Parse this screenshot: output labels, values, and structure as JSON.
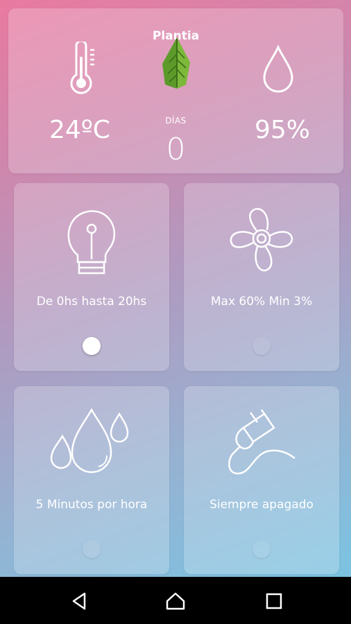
{
  "header": {
    "title": "Plantia",
    "temperature": "24ºC",
    "days_label": "DÍAS",
    "days_value": "0",
    "humidity": "95%"
  },
  "tiles": [
    {
      "icon": "light-bulb-icon",
      "label": "De 0hs hasta 20hs",
      "toggle": "on"
    },
    {
      "icon": "fan-icon",
      "label": "Max 60% Min 3%",
      "toggle": "off"
    },
    {
      "icon": "water-drops-icon",
      "label": "5 Minutos por hora",
      "toggle": "off"
    },
    {
      "icon": "power-plug-icon",
      "label": "Siempre apagado",
      "toggle": "off"
    }
  ],
  "navbar": [
    "back-icon",
    "home-icon",
    "recents-icon"
  ],
  "colors": {
    "background_top": "#e97aa0",
    "background_bottom": "#74c8e6",
    "leaf_green": "#5c9a2a",
    "navbar": "#000000"
  }
}
